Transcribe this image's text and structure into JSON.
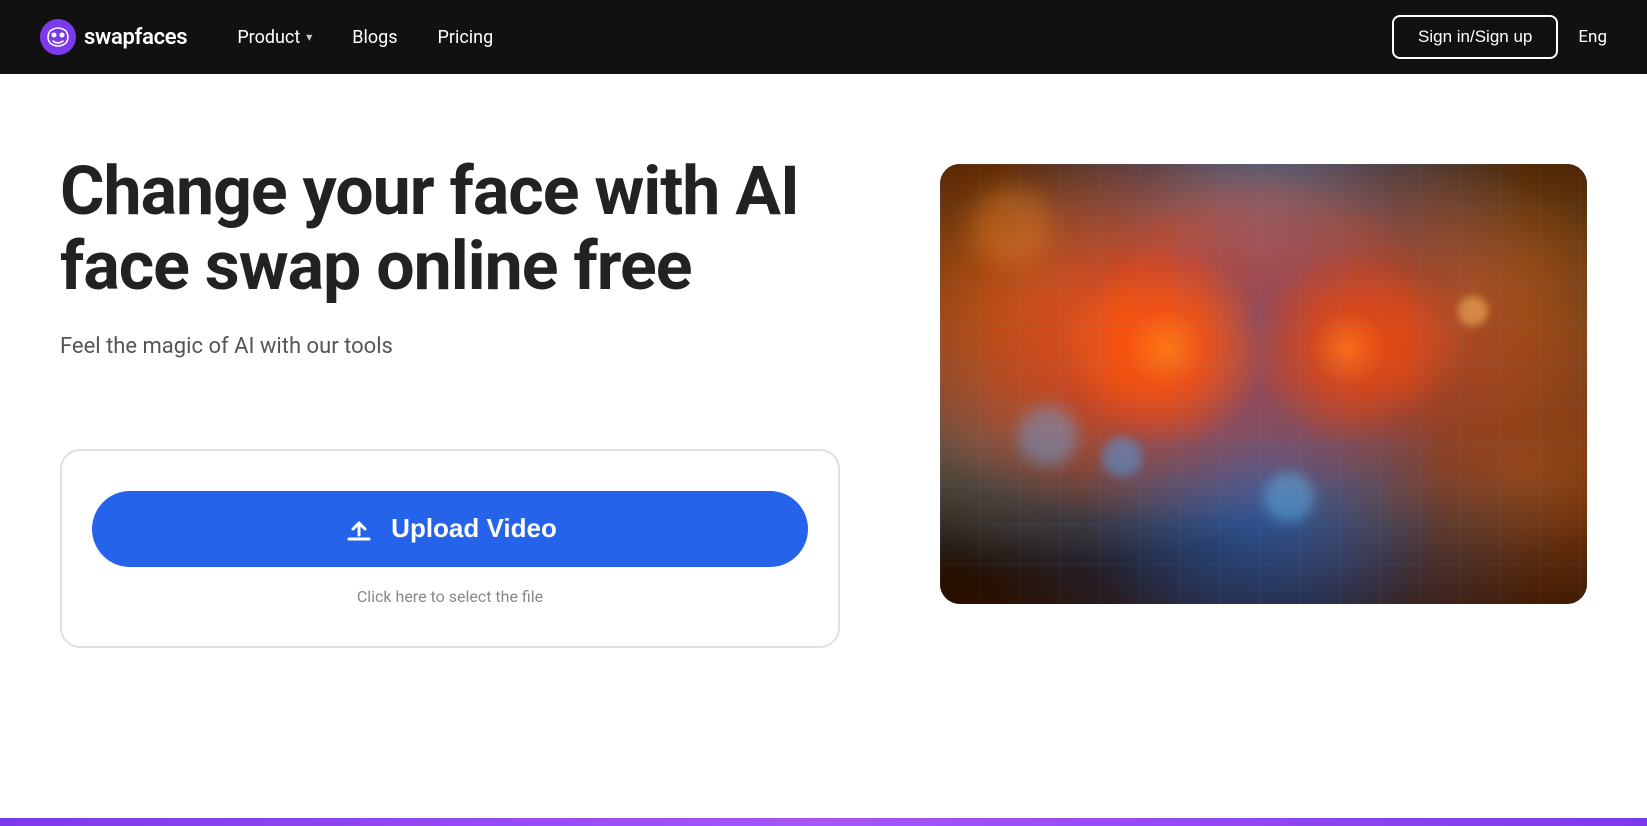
{
  "brand": {
    "name": "swapfaces",
    "logo_icon": "face-swap-icon"
  },
  "navbar": {
    "product_label": "Product",
    "blogs_label": "Blogs",
    "pricing_label": "Pricing",
    "sign_in_label": "Sign in/Sign up",
    "language_label": "Eng"
  },
  "hero": {
    "title": "Change your face with AI face swap online free",
    "subtitle": "Feel the magic of AI with our tools"
  },
  "upload": {
    "button_label": "Upload Video",
    "hint_text": "Click here to select the file"
  }
}
